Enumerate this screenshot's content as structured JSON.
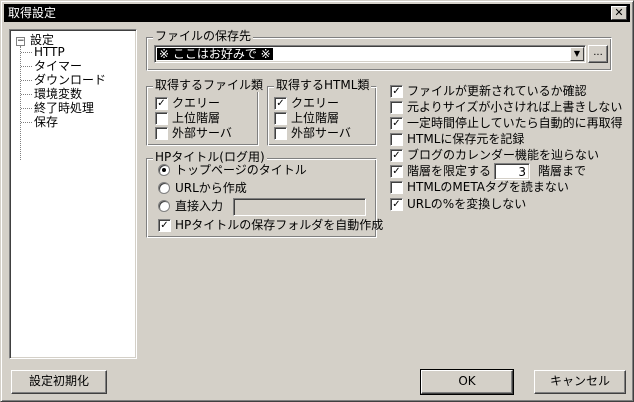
{
  "window": {
    "title": "取得設定",
    "close_glyph": "✕"
  },
  "tree": {
    "expander_glyph": "−",
    "root": "設定",
    "children": [
      "HTTP",
      "タイマー",
      "ダウンロード",
      "環境変数",
      "終了時処理",
      "保存"
    ]
  },
  "save_dest": {
    "label": "ファイルの保存先",
    "value": "※ ここはお好みで ※",
    "dropdown_glyph": "▼",
    "browse_label": "..."
  },
  "file_types": {
    "label": "取得するファイル類",
    "items": [
      {
        "label": "クエリー",
        "checked": true
      },
      {
        "label": "上位階層",
        "checked": false
      },
      {
        "label": "外部サーバ",
        "checked": false
      }
    ]
  },
  "html_types": {
    "label": "取得するHTML類",
    "items": [
      {
        "label": "クエリー",
        "checked": true
      },
      {
        "label": "上位階層",
        "checked": false
      },
      {
        "label": "外部サーバ",
        "checked": false
      }
    ]
  },
  "hp_title": {
    "label": "HPタイトル(ログ用)",
    "radios": [
      {
        "label": "トップページのタイトル",
        "selected": true
      },
      {
        "label": "URLから作成",
        "selected": false
      },
      {
        "label": "直接入力",
        "selected": false
      }
    ],
    "direct_input_value": "",
    "auto_folder": {
      "label": "HPタイトルの保存フォルダを自動作成",
      "checked": true
    }
  },
  "options": [
    {
      "label": "ファイルが更新されているか確認",
      "checked": true
    },
    {
      "label": "元よりサイズが小さければ上書きしない",
      "checked": false
    },
    {
      "label": "一定時間停止していたら自動的に再取得",
      "checked": true
    },
    {
      "label": "HTMLに保存元を記録",
      "checked": false
    },
    {
      "label": "ブログのカレンダー機能を辿らない",
      "checked": true
    },
    {
      "label": "階層を限定する",
      "checked": true
    },
    {
      "label": "HTMLのMETAタグを読まない",
      "checked": false
    },
    {
      "label": "URLの%を変換しない",
      "checked": true
    }
  ],
  "depth_limit": {
    "value": "3",
    "suffix": "階層まで"
  },
  "check_glyph": "✓",
  "buttons": {
    "reset": "設定初期化",
    "ok": "OK",
    "cancel": "キャンセル"
  }
}
